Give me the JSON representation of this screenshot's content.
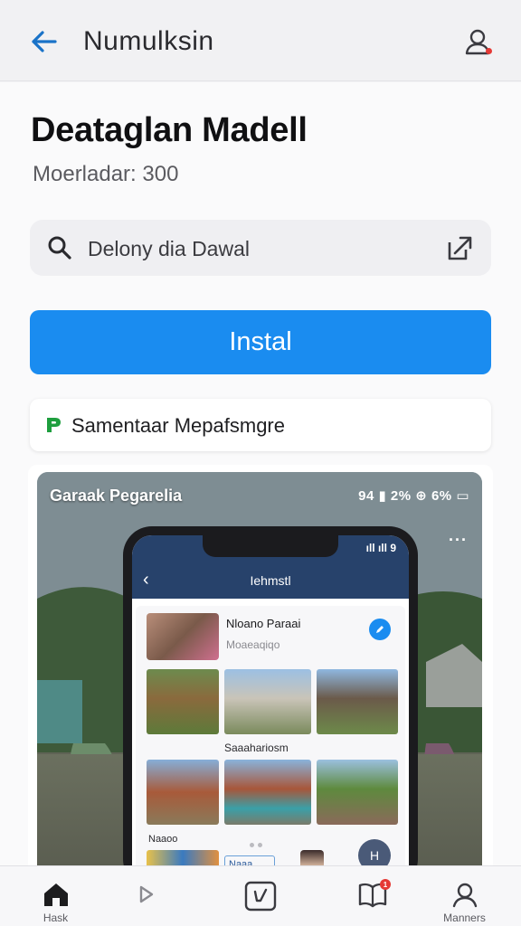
{
  "header": {
    "title": "Numulksin"
  },
  "app": {
    "title": "Deataglan Madell",
    "subtitle": "Moerladar: 300"
  },
  "search": {
    "text": "Delony dia Dawal"
  },
  "install": {
    "label": "Instal"
  },
  "store": {
    "label": "Samentaar Mepafsmgre"
  },
  "screenshot": {
    "header_text": "Garaak Pegarelia",
    "status_text": "94 ▮ 2% ⊕ 6% ▭",
    "more": "...",
    "phone": {
      "status_text": "ıll ıll 9",
      "nav_title": "Iehmstl",
      "item_name": "Nloano Paraai",
      "item_sub": "Moaeaqiqo",
      "grid_label": "Saaahariosm",
      "row_label": "Naaoo",
      "chip_text": "Naaa",
      "fab_label": "H"
    }
  },
  "bottom_nav": {
    "items": [
      {
        "icon": "home-icon",
        "label": "Hask"
      },
      {
        "icon": "play-icon",
        "label": ""
      },
      {
        "icon": "edit-icon",
        "label": ""
      },
      {
        "icon": "book-icon",
        "label": "",
        "badge": "1"
      },
      {
        "icon": "profile-icon",
        "label": "Manners"
      }
    ]
  },
  "colors": {
    "accent": "#1a8cf0",
    "badge": "#e53935",
    "header_bg": "#f1f1f3",
    "store_icon": "#1e9e3e"
  }
}
